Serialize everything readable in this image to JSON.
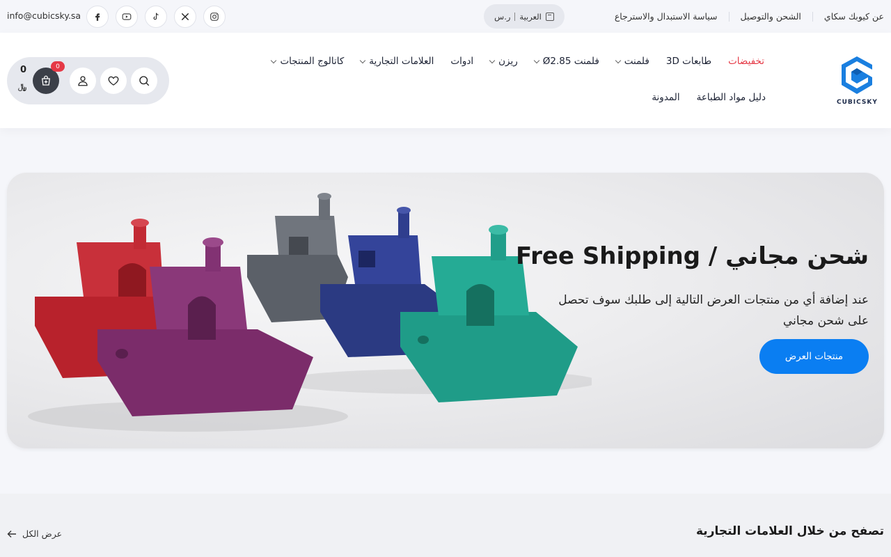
{
  "topbar": {
    "links": [
      "عن كيوبك سكاي",
      "الشحن والتوصيل",
      "سياسة الاستبدال والاسترجاع"
    ],
    "language": "العربية",
    "currency": "ر.س",
    "email": "info@cubicsky.sa",
    "socials": [
      "instagram-icon",
      "x-icon",
      "tiktok-icon",
      "youtube-icon",
      "facebook-icon"
    ]
  },
  "header": {
    "logo_text": "CUBICSKY",
    "nav_row1": [
      {
        "label": "تخفيضات",
        "dropdown": false
      },
      {
        "label": "طابعات 3D",
        "dropdown": false
      },
      {
        "label": "فلمنت",
        "dropdown": true
      },
      {
        "label": "فلمنت Ø2.85",
        "dropdown": true
      },
      {
        "label": "ريزن",
        "dropdown": true
      },
      {
        "label": "ادوات",
        "dropdown": false
      },
      {
        "label": "العلامات التجارية",
        "dropdown": true
      },
      {
        "label": "كاتالوج المنتجات",
        "dropdown": true
      }
    ],
    "nav_row2": [
      {
        "label": "دليل مواد الطباعة",
        "dropdown": false
      },
      {
        "label": "المدونة",
        "dropdown": false
      }
    ],
    "cart": {
      "count": "0",
      "total": "0",
      "currency_symbol": "﷼"
    }
  },
  "hero": {
    "title": "شحن مجاني / Free Shipping",
    "text": "عند إضافة أي من منتجات العرض التالية إلى طلبك سوف تحصل على شحن مجاني",
    "button": "منتجات العرض",
    "colors": {
      "button": "#0a7ef2"
    }
  },
  "brands": {
    "title": "تصفح من خلال العلامات التجارية",
    "view_all": "عرض الكل"
  },
  "colors": {
    "sale": "#e53946",
    "accent": "#0a7ef2",
    "badge": "#e53946"
  }
}
